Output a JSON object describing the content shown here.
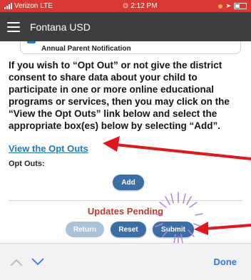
{
  "status_bar": {
    "carrier": "Verizon",
    "network": "LTE",
    "time": "2:12 PM"
  },
  "nav": {
    "title": "Fontana USD"
  },
  "card": {
    "label": "Annual Parent Notification"
  },
  "content": {
    "paragraph": "If you wish to “Opt Out” or not give the district consent to share data about your child to participate in one or more online educational programs or services, then you may click on the “View the Opt Outs” link below and select the appropriate box(es) below by selecting “Add”.",
    "view_link": "View the Opt Outs",
    "opt_outs_label": "Opt Outs:",
    "add_label": "Add",
    "pending_text": "Updates Pending",
    "return_label": "Return",
    "reset_label": "Reset",
    "submit_label": "Submit"
  },
  "toolbar": {
    "done_label": "Done"
  },
  "colors": {
    "status_bar": "#d83a33",
    "nav_bar": "#3e3e40",
    "link": "#2379b8",
    "button": "#3a6ea6",
    "pending": "#b93b2e",
    "arrow": "#e3161c",
    "sparkle": "#b08ad8",
    "done": "#2f7ad3"
  }
}
